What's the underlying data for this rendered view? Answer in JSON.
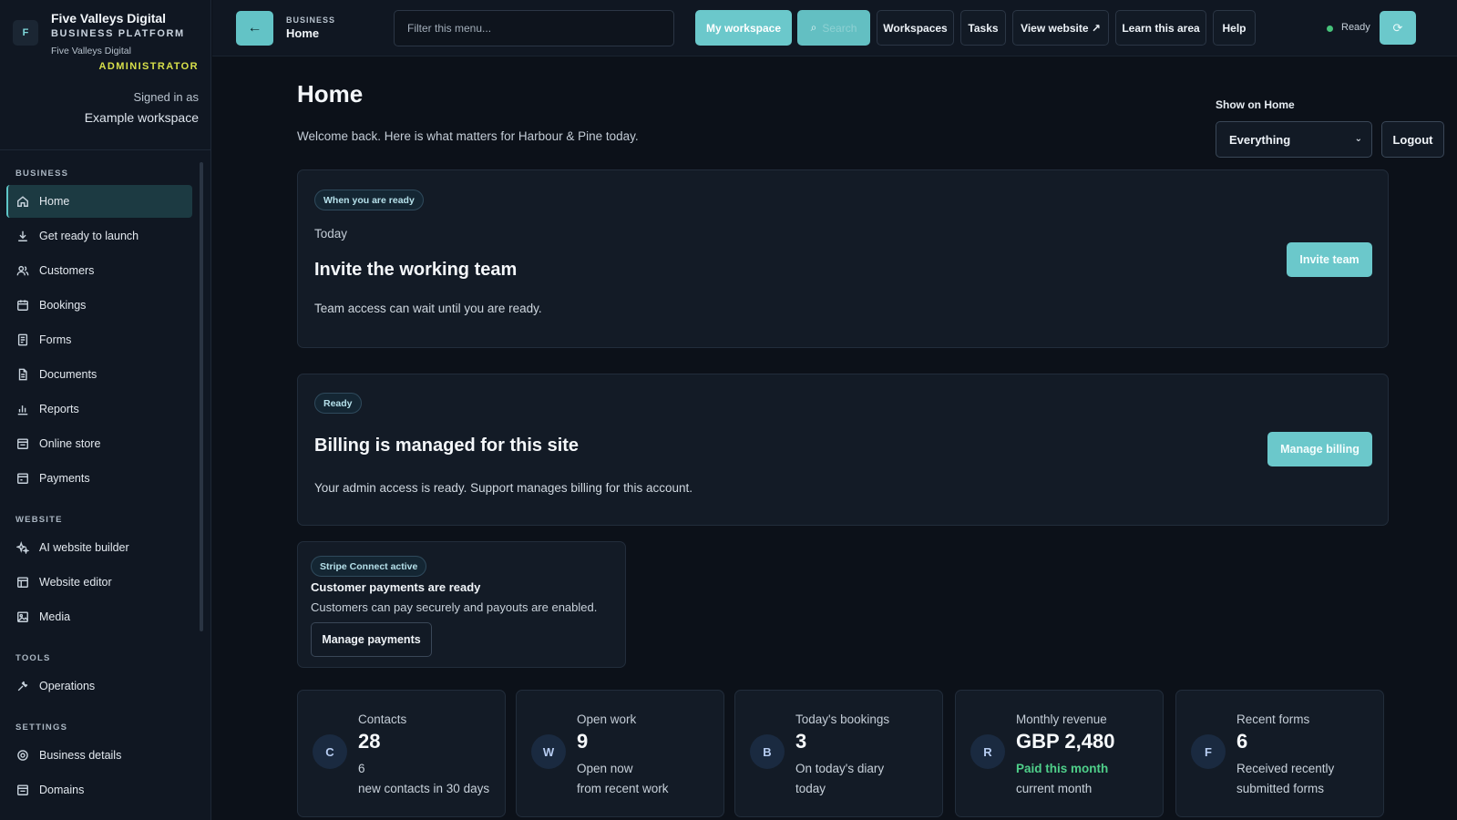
{
  "brand": {
    "logo_glyph": "F",
    "name": "Five Valleys Digital",
    "platform": "BUSINESS PLATFORM",
    "subname": "Five Valleys Digital",
    "role": "ADMINISTRATOR",
    "signed_in_label": "Signed in as",
    "workspace": "Example workspace"
  },
  "sidebar": {
    "sections": [
      {
        "title": "BUSINESS",
        "items": [
          {
            "label": "Home",
            "icon": "home-icon",
            "active": true
          },
          {
            "label": "Get ready to launch",
            "icon": "download-icon"
          },
          {
            "label": "Customers",
            "icon": "users-icon"
          },
          {
            "label": "Bookings",
            "icon": "calendar-icon"
          },
          {
            "label": "Forms",
            "icon": "form-icon"
          },
          {
            "label": "Documents",
            "icon": "document-icon"
          },
          {
            "label": "Reports",
            "icon": "bar-chart-icon"
          },
          {
            "label": "Online store",
            "icon": "store-icon"
          },
          {
            "label": "Payments",
            "icon": "payments-icon"
          }
        ]
      },
      {
        "title": "WEBSITE",
        "items": [
          {
            "label": "AI website builder",
            "icon": "sparkle-icon"
          },
          {
            "label": "Website editor",
            "icon": "layout-icon"
          },
          {
            "label": "Media",
            "icon": "image-icon"
          }
        ]
      },
      {
        "title": "TOOLS",
        "items": [
          {
            "label": "Operations",
            "icon": "tools-icon"
          }
        ]
      },
      {
        "title": "SETTINGS",
        "items": [
          {
            "label": "Business details",
            "icon": "settings-icon"
          },
          {
            "label": "Domains",
            "icon": "domain-icon"
          }
        ]
      }
    ]
  },
  "topbar": {
    "back_glyph": "←",
    "section": "BUSINESS",
    "page": "Home",
    "filter_placeholder": "Filter this menu...",
    "my_workspace": "My workspace",
    "search": "Search",
    "search_glyph": "⌕",
    "workspaces": "Workspaces",
    "tasks": "Tasks",
    "view_website": "View website ↗",
    "learn": "Learn this area",
    "help": "Help",
    "status": "Ready",
    "power_glyph": "⟳"
  },
  "main": {
    "title": "Home",
    "welcome": "Welcome back. Here is what matters for Harbour & Pine today.",
    "show_label": "Show on Home",
    "show_value": "Everything",
    "show_chevron": "⌄",
    "logout": "Logout",
    "invite_card": {
      "badge": "When you are ready",
      "meta": "Today",
      "title": "Invite the working team",
      "body": "Team access can wait until you are ready.",
      "button": "Invite team"
    },
    "billing_card": {
      "badge": "Ready",
      "title": "Billing is managed for this site",
      "body": "Your admin access is ready. Support manages billing for this account.",
      "button": "Manage billing"
    },
    "stripe_card": {
      "badge": "Stripe Connect active",
      "title": "Customer payments are ready",
      "body": "Customers can pay securely and payouts are enabled.",
      "button": "Manage payments"
    },
    "stats": [
      {
        "avatar": "C",
        "label": "Contacts",
        "value": "28",
        "note": "6",
        "sub": "new contacts in 30 days",
        "green": false
      },
      {
        "avatar": "W",
        "label": "Open work",
        "value": "9",
        "note": "Open now",
        "sub": "from recent work",
        "green": false
      },
      {
        "avatar": "B",
        "label": "Today's bookings",
        "value": "3",
        "note": "On today's diary",
        "sub": "today",
        "green": false
      },
      {
        "avatar": "R",
        "label": "Monthly revenue",
        "value": "GBP 2,480",
        "note": "Paid this month",
        "sub": "current month",
        "green": true
      },
      {
        "avatar": "F",
        "label": "Recent forms",
        "value": "6",
        "note": "Received recently",
        "sub": "submitted forms",
        "green": false
      }
    ]
  }
}
